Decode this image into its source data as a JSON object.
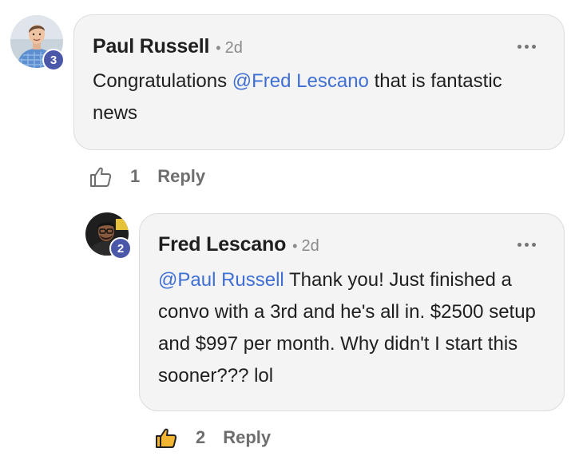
{
  "comments": [
    {
      "author": "Paul Russell",
      "separator": "•",
      "time": "2d",
      "level": "3",
      "text_parts": [
        "Congratulations ",
        "@Fred Lescano",
        " that is fantastic news"
      ],
      "likes": "1",
      "reply_label": "Reply",
      "liked": false
    },
    {
      "author": "Fred Lescano",
      "separator": "•",
      "time": "2d",
      "level": "2",
      "text_parts": [
        "@Paul Russell",
        " Thank you! Just finished a convo with a 3rd and he's all in. $2500 setup and $997 per month. Why didn't I start this sooner??? lol"
      ],
      "likes": "2",
      "reply_label": "Reply",
      "liked": true
    }
  ],
  "colors": {
    "mention": "#3f6fd4",
    "badge": "#4b57a8",
    "like_active_fill": "#f2b632",
    "muted": "#6e6e6e"
  },
  "icons": {
    "more": "more-horizontal-icon",
    "like": "thumbs-up-icon"
  }
}
